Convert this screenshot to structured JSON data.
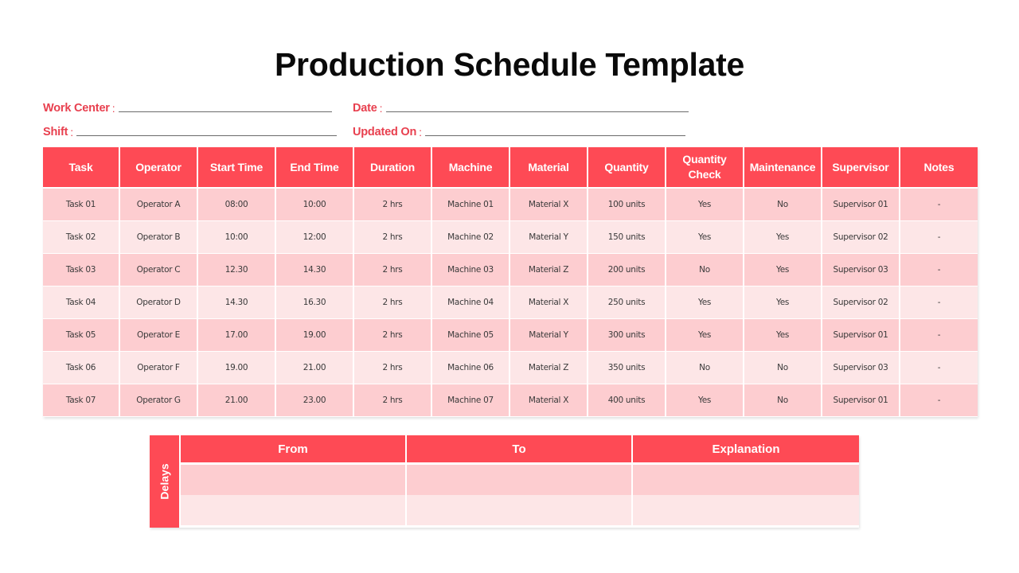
{
  "title": "Production Schedule Template",
  "fields": {
    "work_center": {
      "label": "Work Center",
      "colon": ":",
      "value": ""
    },
    "shift": {
      "label": "Shift",
      "colon": ":",
      "value": ""
    },
    "date": {
      "label": "Date",
      "colon": ":",
      "value": ""
    },
    "updated_on": {
      "label": "Updated On",
      "colon": ":",
      "value": ""
    }
  },
  "colors": {
    "accent": "#fe4a55",
    "label": "#e8404f",
    "row_dark": "#fdcdd0",
    "row_light": "#fde6e7"
  },
  "schedule": {
    "headers": [
      "Task",
      "Operator",
      "Start Time",
      "End Time",
      "Duration",
      "Machine",
      "Material",
      "Quantity",
      "Quantity Check",
      "Maintenance",
      "Supervisor",
      "Notes"
    ],
    "rows": [
      [
        "Task 01",
        "Operator A",
        "08:00",
        "10:00",
        "2 hrs",
        "Machine 01",
        "Material X",
        "100 units",
        "Yes",
        "No",
        "Supervisor 01",
        "-"
      ],
      [
        "Task 02",
        "Operator B",
        "10:00",
        "12:00",
        "2 hrs",
        "Machine 02",
        "Material Y",
        "150 units",
        "Yes",
        "Yes",
        "Supervisor 02",
        "-"
      ],
      [
        "Task 03",
        "Operator C",
        "12.30",
        "14.30",
        "2 hrs",
        "Machine 03",
        "Material Z",
        "200 units",
        "No",
        "Yes",
        "Supervisor 03",
        "-"
      ],
      [
        "Task 04",
        "Operator D",
        "14.30",
        "16.30",
        "2 hrs",
        "Machine 04",
        "Material X",
        "250 units",
        "Yes",
        "Yes",
        "Supervisor 02",
        "-"
      ],
      [
        "Task 05",
        "Operator E",
        "17.00",
        "19.00",
        "2 hrs",
        "Machine 05",
        "Material Y",
        "300 units",
        "Yes",
        "Yes",
        "Supervisor 01",
        "-"
      ],
      [
        "Task 06",
        "Operator F",
        "19.00",
        "21.00",
        "2 hrs",
        "Machine 06",
        "Material Z",
        "350 units",
        "No",
        "No",
        "Supervisor 03",
        "-"
      ],
      [
        "Task 07",
        "Operator G",
        "21.00",
        "23.00",
        "2 hrs",
        "Machine 07",
        "Material X",
        "400 units",
        "Yes",
        "No",
        "Supervisor 01",
        "-"
      ]
    ]
  },
  "delays": {
    "side_label": "Delays",
    "headers": [
      "From",
      "To",
      "Explanation"
    ],
    "rows": [
      [
        "",
        "",
        ""
      ],
      [
        "",
        "",
        ""
      ]
    ]
  }
}
